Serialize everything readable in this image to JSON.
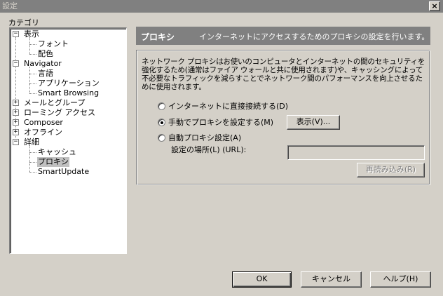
{
  "window": {
    "title": "設定",
    "close_glyph": "×"
  },
  "category_label": "カテゴリ",
  "tree": {
    "expand_glyph": "−",
    "collapse_glyph": "+",
    "items": [
      {
        "label": "表示"
      },
      {
        "label": "フォント"
      },
      {
        "label": "配色"
      },
      {
        "label": "Navigator"
      },
      {
        "label": "言語"
      },
      {
        "label": "アプリケーション"
      },
      {
        "label": "Smart Browsing"
      },
      {
        "label": "メールとグループ"
      },
      {
        "label": "ローミング アクセス"
      },
      {
        "label": "Composer"
      },
      {
        "label": "オフライン"
      },
      {
        "label": "詳細"
      },
      {
        "label": "キャッシュ"
      },
      {
        "label": "プロキシ"
      },
      {
        "label": "SmartUpdate"
      }
    ]
  },
  "header": {
    "title": "プロキシ",
    "description": "インターネットにアクセスするためのプロキシの設定を行います。"
  },
  "proxy": {
    "description": "ネットワーク プロキシはお使いのコンピュータとインターネットの間のセキュリティを強化するため(通常はファイア ウォールと共に使用されます)や、キャッシングによって不必要なトラフィックを減らすことでネットワーク間のパフォーマンスを向上させるために使用されます。",
    "option_direct": "インターネットに直接接続する(D)",
    "option_manual": "手動でプロキシを設定する(M)",
    "option_auto": "自動プロキシ設定(A)",
    "view_button": "表示(V)...",
    "location_label": "設定の場所(L) (URL):",
    "location_value": "",
    "reload_button": "再読み込み(R)"
  },
  "footer": {
    "ok": "OK",
    "cancel": "キャンセル",
    "help": "ヘルプ(H)"
  },
  "colors": {
    "face": "#d4d0c8",
    "shadow": "#808080",
    "highlight": "#ffffff",
    "title_bar": "#808080"
  }
}
